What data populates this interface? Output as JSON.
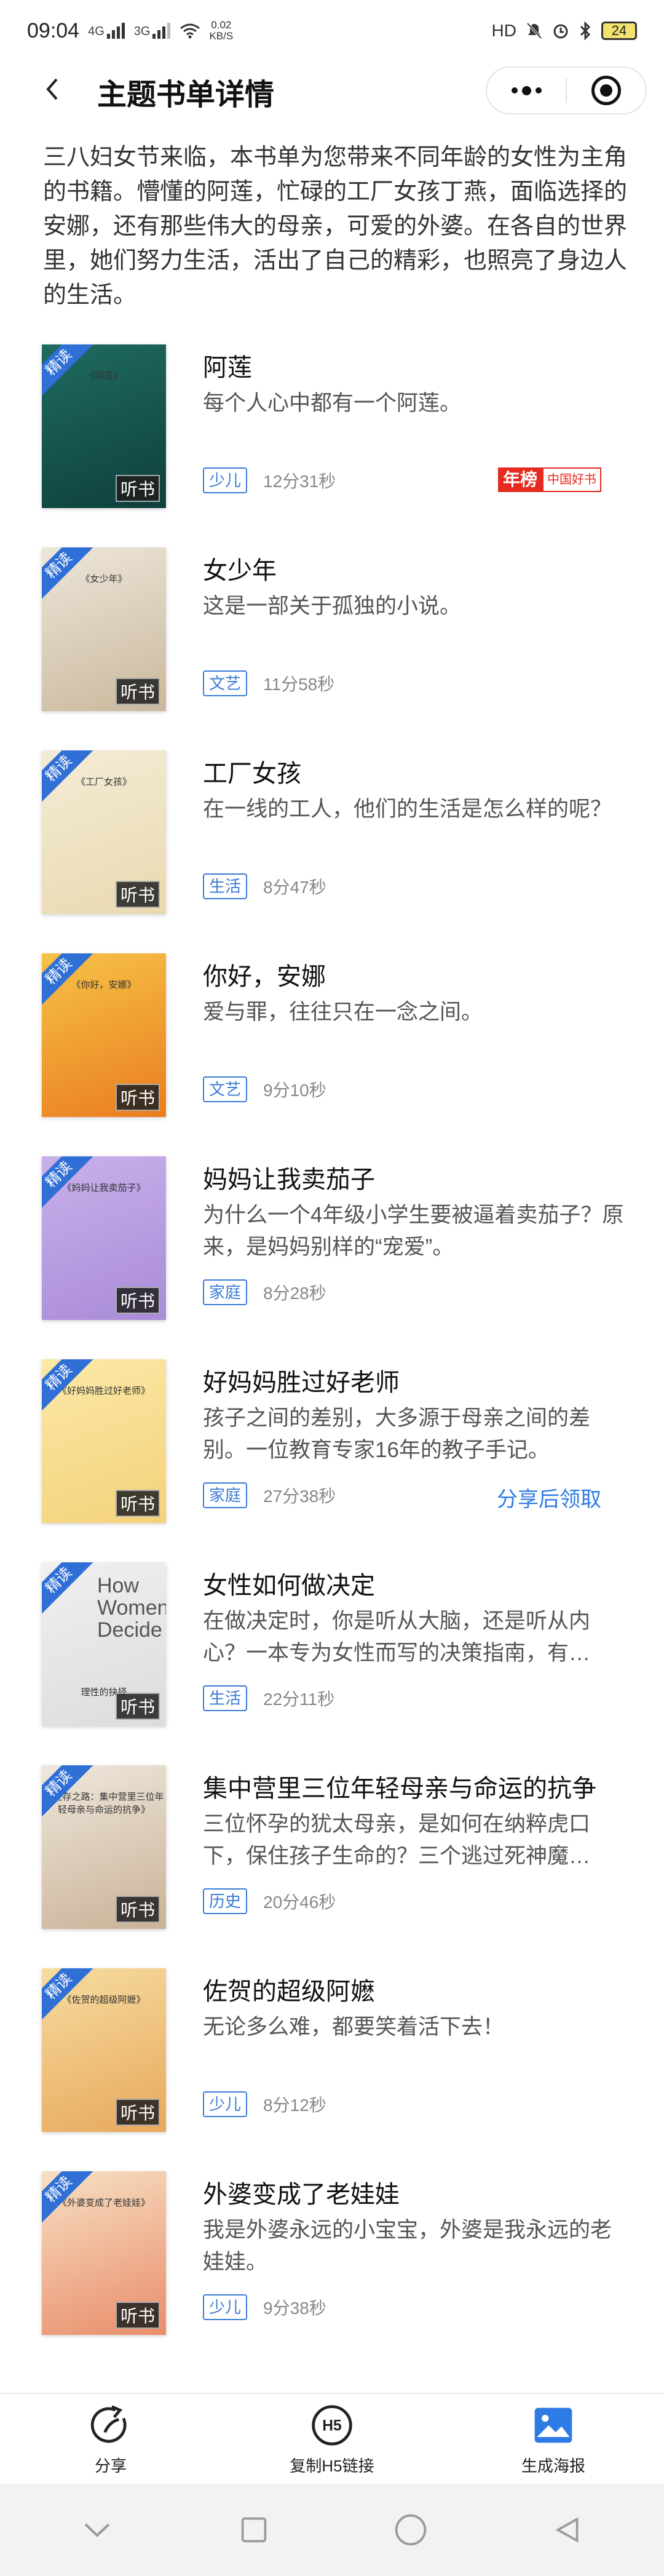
{
  "status_bar": {
    "time": "09:04",
    "signal1": "4G",
    "signal2": "3G",
    "speed_value": "0.02",
    "speed_unit": "KB/S",
    "hd_label": "HD",
    "battery": "24"
  },
  "nav": {
    "title": "主题书单详情"
  },
  "intro": "三八妇女节来临，本书单为您带来不同年龄的女性为主角的书籍。懵懂的阿莲，忙碌的工厂女孩丁燕，面临选择的安娜，还有那些伟大的母亲，可爱的外婆。在各自的世界里，她们努力生活，活出了自己的精彩，也照亮了身边人的生活。",
  "badges": {
    "jingdu": "精读",
    "tingshu": "听书"
  },
  "books": [
    {
      "title": "阿莲",
      "desc": "每个人心中都有一个阿莲。",
      "tag": "少儿",
      "duration": "12分31秒",
      "cover_title": "《阿莲》",
      "rank_label": "年榜",
      "rank_source": "中国好书",
      "colors": [
        "#1f6b61",
        "#0e3f3c"
      ]
    },
    {
      "title": "女少年",
      "desc": "这是一部关于孤独的小说。",
      "tag": "文艺",
      "duration": "11分58秒",
      "cover_title": "《女少年》",
      "colors": [
        "#eee6da",
        "#c9b89c"
      ]
    },
    {
      "title": "工厂女孩",
      "desc": "在一线的工人，他们的生活是怎么样的呢？",
      "tag": "生活",
      "duration": "8分47秒",
      "cover_title": "《工厂女孩》",
      "colors": [
        "#f3ecd6",
        "#e9d9b0"
      ]
    },
    {
      "title": "你好，安娜",
      "desc": "爱与罪，往往只在一念之间。",
      "tag": "文艺",
      "duration": "9分10秒",
      "cover_title": "《你好，安娜》",
      "colors": [
        "#f6c247",
        "#ea7d1f"
      ]
    },
    {
      "title": "妈妈让我卖茄子",
      "desc": "为什么一个4年级小学生要被逼着卖茄子？原来，是妈妈别样的“宠爱”。",
      "tag": "家庭",
      "duration": "8分28秒",
      "cover_title": "《妈妈让我卖茄子》",
      "colors": [
        "#c9b0ea",
        "#a98bd8"
      ]
    },
    {
      "title": "好妈妈胜过好老师",
      "desc": "孩子之间的差别，大多源于母亲之间的差别。一位教育专家16年的教子手记。",
      "tag": "家庭",
      "duration": "27分38秒",
      "cover_title": "《好妈妈胜过好老师》",
      "share": "分享后领取",
      "colors": [
        "#fbe8a8",
        "#f4d27a"
      ]
    },
    {
      "title": "女性如何做决定",
      "desc": "在做决定时，你是听从大脑，还是听从内心？一本专为女性而写的决策指南，有…",
      "tag": "生活",
      "duration": "22分11秒",
      "cover_title": "理性的抉择",
      "cover_en": "How Women Decide",
      "colors": [
        "#f0f0f0",
        "#dcdcdc"
      ]
    },
    {
      "title": "集中营里三位年轻母亲与命运的抗争",
      "desc": "三位怀孕的犹太母亲，是如何在纳粹虎口下，保住孩子生命的？三个逃过死神魔…",
      "tag": "历史",
      "duration": "20分46秒",
      "cover_title": "《生存之路：集中营里三位年轻母亲与命运的抗争》",
      "colors": [
        "#efe7dc",
        "#c9b297"
      ]
    },
    {
      "title": "佐贺的超级阿嬷",
      "desc": "无论多么难，都要笑着活下去！",
      "tag": "少儿",
      "duration": "8分12秒",
      "cover_title": "《佐贺的超级阿嬷》",
      "colors": [
        "#f6dca0",
        "#e8a85c"
      ]
    },
    {
      "title": "外婆变成了老娃娃",
      "desc": "我是外婆永远的小宝宝，外婆是我永远的老娃娃。",
      "tag": "少儿",
      "duration": "9分38秒",
      "cover_title": "《外婆变成了老娃娃》",
      "colors": [
        "#f7e0c4",
        "#e98d6a"
      ]
    }
  ],
  "toolbar": {
    "share": "分享",
    "h5": "复制H5链接",
    "h5_icon_text": "H5",
    "poster": "生成海报"
  },
  "colors": {
    "accent": "#2f6fd6",
    "tag_blue": "#3a7bd5",
    "rank_red": "#e52a1f"
  }
}
